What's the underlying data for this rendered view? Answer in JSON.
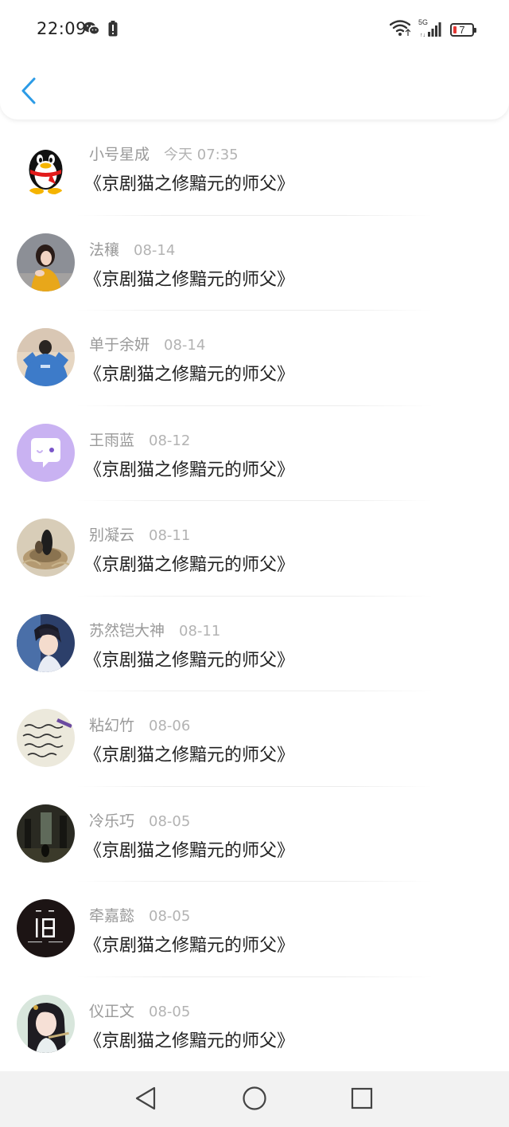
{
  "status_bar": {
    "time": "22:09",
    "battery_level": "7",
    "network_label": "5G",
    "colors": {
      "battery_low": "#e53935"
    }
  },
  "header": {
    "back_icon": "chevron-left-icon",
    "accent": "#2c9be6"
  },
  "messages": [
    {
      "name": "小号星成",
      "date": "今天 07:35",
      "text": "《京剧猫之修黯元的师父》",
      "avatar": "penguin-avatar"
    },
    {
      "name": "法穰",
      "date": "08-14",
      "text": "《京剧猫之修黯元的师父》",
      "avatar": "girl-yellow-sweater-avatar"
    },
    {
      "name": "单于余妍",
      "date": "08-14",
      "text": "《京剧猫之修黯元的师父》",
      "avatar": "person-blue-jacket-avatar"
    },
    {
      "name": "王雨蓝",
      "date": "08-12",
      "text": "《京剧猫之修黯元的师父》",
      "avatar": "chat-bubble-avatar"
    },
    {
      "name": "别凝云",
      "date": "08-11",
      "text": "《京剧猫之修黯元的师父》",
      "avatar": "birds-nest-avatar"
    },
    {
      "name": "苏然铠大神",
      "date": "08-11",
      "text": "《京剧猫之修黯元的师父》",
      "avatar": "anime-boy-avatar"
    },
    {
      "name": "粘幻竹",
      "date": "08-06",
      "text": "《京剧猫之修黯元的师父》",
      "avatar": "handwriting-avatar"
    },
    {
      "name": "冷乐巧",
      "date": "08-05",
      "text": "《京剧猫之修黯元的师父》",
      "avatar": "dark-forest-avatar"
    },
    {
      "name": "牵嘉懿",
      "date": "08-05",
      "text": "《京剧猫之修黯元的师父》",
      "avatar": "text-logo-avatar"
    },
    {
      "name": "仪正文",
      "date": "08-05",
      "text": "《京剧猫之修黯元的师父》",
      "avatar": "anime-girl-avatar"
    }
  ],
  "nav_bar": {
    "back": "triangle-back-icon",
    "home": "circle-home-icon",
    "recents": "square-recents-icon"
  }
}
